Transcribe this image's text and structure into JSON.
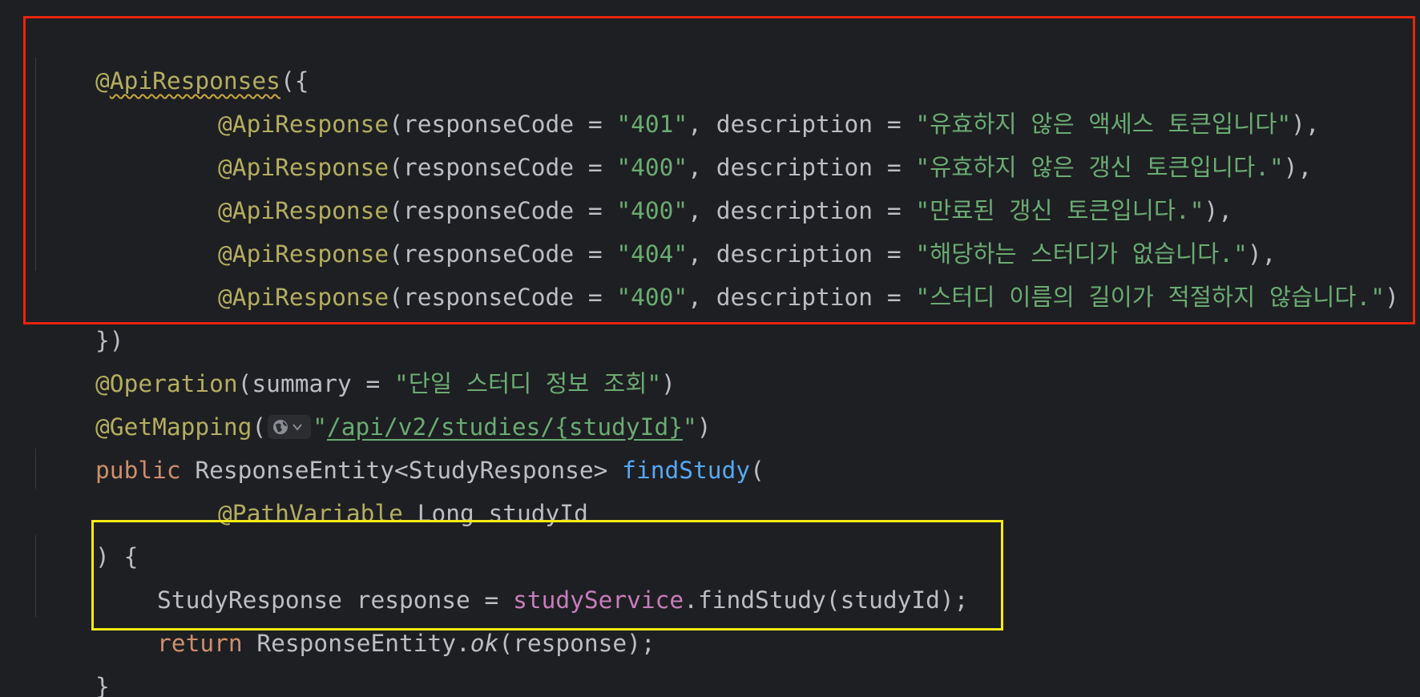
{
  "editor": {
    "lines": {
      "l1": {
        "at": "@",
        "name": "ApiResponses",
        "rest": "({"
      },
      "l2": {
        "ann": "@ApiResponse",
        "p1": "(responseCode = ",
        "code": "\"401\"",
        "p2": ", description = ",
        "desc": "\"유효하지 않은 액세스 토큰입니다\"",
        "end": "),"
      },
      "l3": {
        "ann": "@ApiResponse",
        "p1": "(responseCode = ",
        "code": "\"400\"",
        "p2": ", description = ",
        "desc": "\"유효하지 않은 갱신 토큰입니다.\"",
        "end": "),"
      },
      "l4": {
        "ann": "@ApiResponse",
        "p1": "(responseCode = ",
        "code": "\"400\"",
        "p2": ", description = ",
        "desc": "\"만료된 갱신 토큰입니다.\"",
        "end": "),"
      },
      "l5": {
        "ann": "@ApiResponse",
        "p1": "(responseCode = ",
        "code": "\"404\"",
        "p2": ", description = ",
        "desc": "\"해당하는 스터디가 없습니다.\"",
        "end": "),"
      },
      "l6": {
        "ann": "@ApiResponse",
        "p1": "(responseCode = ",
        "code": "\"400\"",
        "p2": ", description = ",
        "desc": "\"스터디 이름의 길이가 적절하지 않습니다.\"",
        "end": ")"
      },
      "l7": {
        "text": "})"
      },
      "l8": {
        "ann": "@Operation",
        "p1": "(summary = ",
        "str": "\"단일 스터디 정보 조회\"",
        "end": ")"
      },
      "l9": {
        "ann": "@GetMapping",
        "p1": "(",
        "q1": "\"",
        "url": "/api/v2/studies/{studyId}",
        "q2": "\"",
        "end": ")"
      },
      "l10": {
        "kw": "public",
        "type": " ResponseEntity<StudyResponse> ",
        "fn": "findStudy",
        "end": "("
      },
      "l11": {
        "ann": "@PathVariable",
        "rest": " Long studyId"
      },
      "l12": {
        "text": ") {"
      },
      "l13": {
        "p1": "StudyResponse response = ",
        "field": "studyService",
        "rest": ".findStudy(studyId);"
      },
      "l14": {
        "kw": "return",
        "p1": " ResponseEntity.",
        "method": "ok",
        "rest": "(response);"
      },
      "l15": {
        "text": "}"
      }
    }
  },
  "icons": {
    "url_action": "globe-icon",
    "dropdown": "chevron-down-icon"
  },
  "colors": {
    "background": "#1e1f22",
    "annotation": "#b3ae60",
    "string": "#6aab73",
    "keyword": "#cf8e6d",
    "function": "#56a8f5",
    "field": "#c77dbb",
    "highlight_red": "#e8250c",
    "highlight_yellow": "#f5ea14"
  }
}
